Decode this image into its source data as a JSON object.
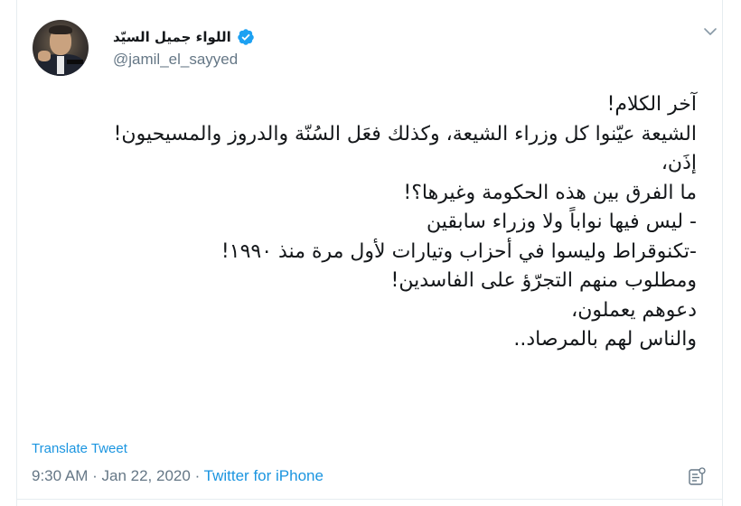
{
  "author": {
    "display_name": "اللواء جميل السيّد",
    "handle": "@jamil_el_sayyed",
    "verified": true
  },
  "tweet": {
    "lines": [
      "آخر الكلام!",
      "الشيعة عيّنوا كل وزراء الشيعة، وكذلك فعَل السُنّة والدروز  والمسيحيون!",
      "إذَن،",
      "ما الفرق بين هذه الحكومة وغيرها؟!",
      "- ليس فيها نواباً ولا وزراء سابقين",
      "-تكنوقراط وليسوا في أحزاب وتيارات لأول مرة منذ ١٩٩٠!",
      "ومطلوب منهم التجرّؤ على الفاسدين!",
      "دعوهم يعملون،",
      "والناس لهم بالمرصاد.."
    ],
    "translate_label": "Translate Tweet",
    "time": "9:30 AM",
    "separator": "·",
    "date": "Jan 22, 2020",
    "source": "Twitter for iPhone"
  },
  "icons": {
    "verified": "verified-badge-icon",
    "caret": "chevron-down-icon",
    "analytics": "tweet-analytics-icon"
  },
  "colors": {
    "link": "#1b95e0",
    "verified": "#1da1f2",
    "secondary_text": "#657786",
    "primary_text": "#14171a"
  }
}
